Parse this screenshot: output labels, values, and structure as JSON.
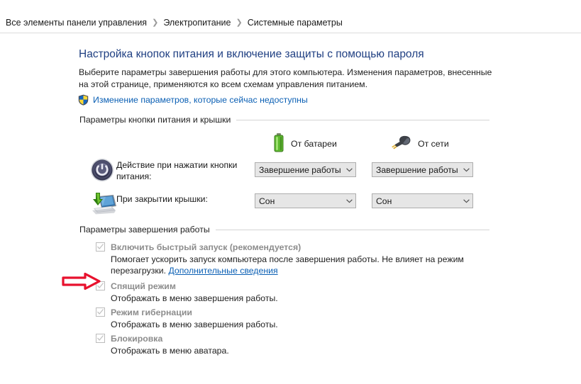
{
  "breadcrumb": {
    "separator": "❯",
    "items": [
      {
        "label": "Все элементы панели управления"
      },
      {
        "label": "Электропитание"
      },
      {
        "label": "Системные параметры"
      }
    ]
  },
  "page": {
    "title": "Настройка кнопок питания и включение защиты с помощью пароля",
    "description": "Выберите параметры завершения работы для этого компьютера. Изменения параметров, внесенные на этой странице, применяются ко всем схемам управления питанием.",
    "uac_link": "Изменение параметров, которые сейчас недоступны",
    "shield_icon": "uac-shield-icon"
  },
  "power_buttons_group": {
    "legend": "Параметры кнопки питания и крышки",
    "sources": [
      {
        "label": "От батареи",
        "icon": "battery-icon"
      },
      {
        "label": "От сети",
        "icon": "power-plug-icon"
      }
    ],
    "rows": [
      {
        "icon": "power-button-icon",
        "label": "Действие при нажатии кнопки питания:",
        "battery_value": "Завершение работы",
        "ac_value": "Завершение работы"
      },
      {
        "icon": "laptop-lid-icon",
        "label": "При закрытии крышки:",
        "battery_value": "Сон",
        "ac_value": "Сон"
      }
    ]
  },
  "shutdown_group": {
    "legend": "Параметры завершения работы",
    "items": [
      {
        "label": "Включить быстрый запуск (рекомендуется)",
        "checked": true,
        "desc_before": "Помогает ускорить запуск компьютера после завершения работы. Не влияет на режим перезагрузки. ",
        "link": "Дополнительные сведения"
      },
      {
        "label": "Спящий режим",
        "checked": true,
        "desc_before": "Отображать в меню завершения работы.",
        "link": ""
      },
      {
        "label": "Режим гибернации",
        "checked": true,
        "desc_before": "Отображать в меню завершения работы.",
        "link": ""
      },
      {
        "label": "Блокировка",
        "checked": true,
        "desc_before": "Отображать в меню аватара.",
        "link": ""
      }
    ]
  },
  "annotation": {
    "arrow_icon": "red-arrow-right-icon",
    "color": "#e8112d"
  },
  "colors": {
    "title_blue": "#1f3f82",
    "link_blue": "#0a5fb4",
    "disabled_text": "#8c8c8c",
    "combo_fill": "#e6e6e6",
    "combo_border": "#adadad",
    "rule": "#d4d4d4"
  }
}
